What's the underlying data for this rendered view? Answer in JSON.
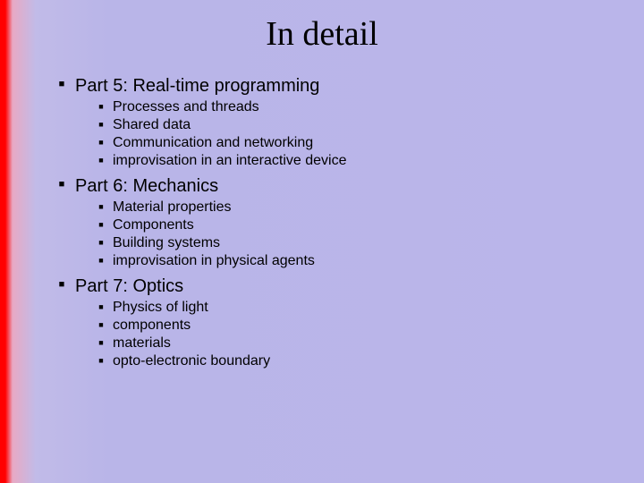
{
  "title": "In detail",
  "sections": [
    {
      "heading": "Part 5: Real-time programming",
      "items": [
        "Processes and threads",
        "Shared data",
        "Communication and networking",
        "improvisation in an interactive device"
      ]
    },
    {
      "heading": "Part 6: Mechanics",
      "items": [
        "Material properties",
        "Components",
        "Building systems",
        "improvisation in physical agents"
      ]
    },
    {
      "heading": "Part 7: Optics",
      "items": [
        "Physics of light",
        "components",
        "materials",
        "opto-electronic boundary"
      ]
    }
  ]
}
